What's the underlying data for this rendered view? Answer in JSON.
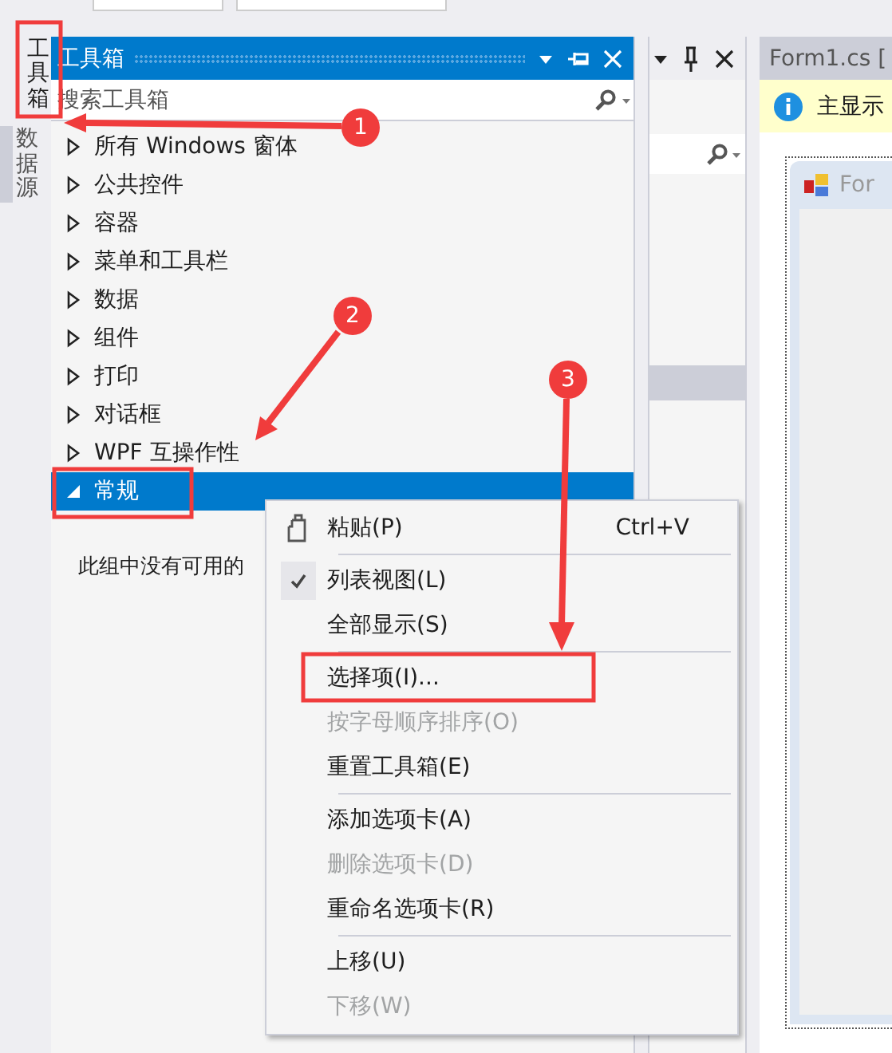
{
  "side_tabs": [
    {
      "label": "工具箱",
      "selected": true
    },
    {
      "label": "数据源",
      "selected": false
    }
  ],
  "toolbox": {
    "title": "工具箱",
    "search": {
      "placeholder": "搜索工具箱"
    },
    "groups": [
      {
        "label": "所有 Windows 窗体",
        "expanded": false,
        "selected": false
      },
      {
        "label": "公共控件",
        "expanded": false,
        "selected": false
      },
      {
        "label": "容器",
        "expanded": false,
        "selected": false
      },
      {
        "label": "菜单和工具栏",
        "expanded": false,
        "selected": false
      },
      {
        "label": "数据",
        "expanded": false,
        "selected": false
      },
      {
        "label": "组件",
        "expanded": false,
        "selected": false
      },
      {
        "label": "打印",
        "expanded": false,
        "selected": false
      },
      {
        "label": "对话框",
        "expanded": false,
        "selected": false
      },
      {
        "label": "WPF 互操作性",
        "expanded": false,
        "selected": false
      },
      {
        "label": "常规",
        "expanded": true,
        "selected": true
      }
    ],
    "empty_message": "此组中没有可用的"
  },
  "designer": {
    "tab_title": "Form1.cs [",
    "info_text": "主显示",
    "form_title": "For"
  },
  "context_menu": {
    "items": [
      {
        "kind": "item",
        "label": "粘贴(P)",
        "shortcut": "Ctrl+V",
        "icon": true,
        "checked": false,
        "disabled": false
      },
      {
        "kind": "separator"
      },
      {
        "kind": "item",
        "label": "列表视图(L)",
        "icon": false,
        "checked": true,
        "disabled": false
      },
      {
        "kind": "item",
        "label": "全部显示(S)",
        "icon": false,
        "checked": false,
        "disabled": false
      },
      {
        "kind": "separator"
      },
      {
        "kind": "item",
        "label": "选择项(I)...",
        "icon": false,
        "checked": false,
        "disabled": false
      },
      {
        "kind": "item",
        "label": "按字母顺序排序(O)",
        "icon": false,
        "checked": false,
        "disabled": true
      },
      {
        "kind": "item",
        "label": "重置工具箱(E)",
        "icon": false,
        "checked": false,
        "disabled": false
      },
      {
        "kind": "separator"
      },
      {
        "kind": "item",
        "label": "添加选项卡(A)",
        "icon": false,
        "checked": false,
        "disabled": false
      },
      {
        "kind": "item",
        "label": "删除选项卡(D)",
        "icon": false,
        "checked": false,
        "disabled": true
      },
      {
        "kind": "item",
        "label": "重命名选项卡(R)",
        "icon": false,
        "checked": false,
        "disabled": false
      },
      {
        "kind": "separator"
      },
      {
        "kind": "item",
        "label": "上移(U)",
        "icon": false,
        "checked": false,
        "disabled": false
      },
      {
        "kind": "item",
        "label": "下移(W)",
        "icon": false,
        "checked": false,
        "disabled": true
      }
    ]
  },
  "annotations": [
    {
      "number": "1"
    },
    {
      "number": "2"
    },
    {
      "number": "3"
    }
  ]
}
